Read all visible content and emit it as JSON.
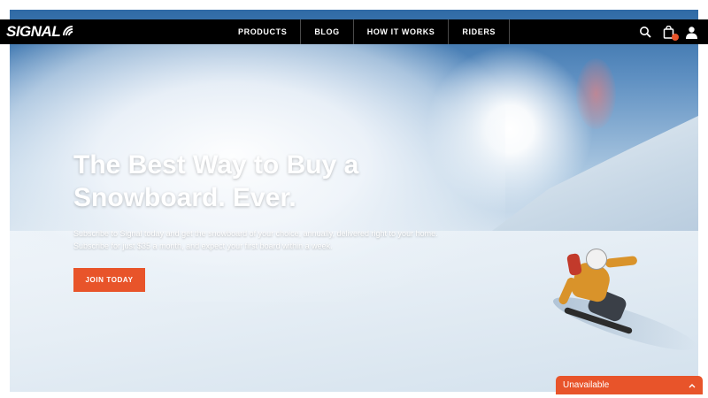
{
  "brand": {
    "logo_text": "SIGNAL"
  },
  "nav": {
    "items": [
      {
        "label": "PRODUCTS"
      },
      {
        "label": "BLOG"
      },
      {
        "label": "HOW IT WORKS"
      },
      {
        "label": "RIDERS"
      }
    ],
    "icons": [
      "search-icon",
      "cart-icon",
      "user-icon"
    ]
  },
  "hero": {
    "title": "The Best Way to Buy a Snowboard. Ever.",
    "description": "Subscribe to Signal today and get the snowboard of your choice, annually, delivered right to your home. Subscribe for just $35 a month, and expect your first board within a week.",
    "cta_label": "JOIN TODAY"
  },
  "status_tab": {
    "label": "Unavailable"
  },
  "colors": {
    "accent": "#e8542a",
    "nav_bg": "#000000"
  }
}
